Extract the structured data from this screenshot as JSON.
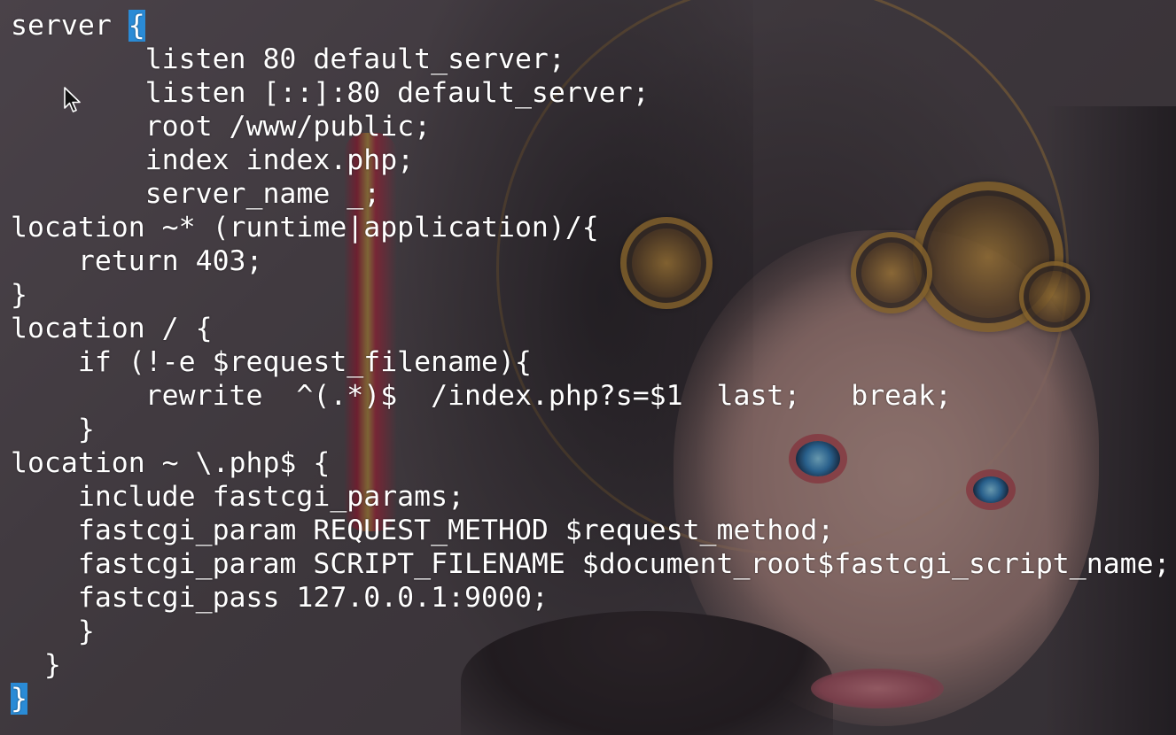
{
  "terminal": {
    "lines": [
      [
        "server ",
        "{"
      ],
      [
        "        listen 80 default_server;"
      ],
      [
        "        listen [::]:80 default_server;"
      ],
      [
        "        root /www/public;"
      ],
      [
        "        index index.php;"
      ],
      [
        "        server_name _;"
      ],
      [
        "location ~* (runtime|application)/{"
      ],
      [
        "    return 403;"
      ],
      [
        "}"
      ],
      [
        "location / {"
      ],
      [
        "    if (!-e $request_filename){"
      ],
      [
        "        rewrite  ^(.*)$  /index.php?s=$1  last;   break;"
      ],
      [
        "    }"
      ],
      [
        "location ~ \\.php$ {"
      ],
      [
        "    include fastcgi_params;"
      ],
      [
        "    fastcgi_param REQUEST_METHOD $request_method;"
      ],
      [
        "    fastcgi_param SCRIPT_FILENAME $document_root$fastcgi_script_name;"
      ],
      [
        "    fastcgi_pass 127.0.0.1:9000;"
      ],
      [
        "    }"
      ],
      [
        "  }"
      ],
      [
        "",
        "}"
      ]
    ],
    "highlight_color": "#2a8bd6",
    "text_color": "#ffffff"
  },
  "icons": {
    "pointer": "mouse-pointer-icon"
  }
}
